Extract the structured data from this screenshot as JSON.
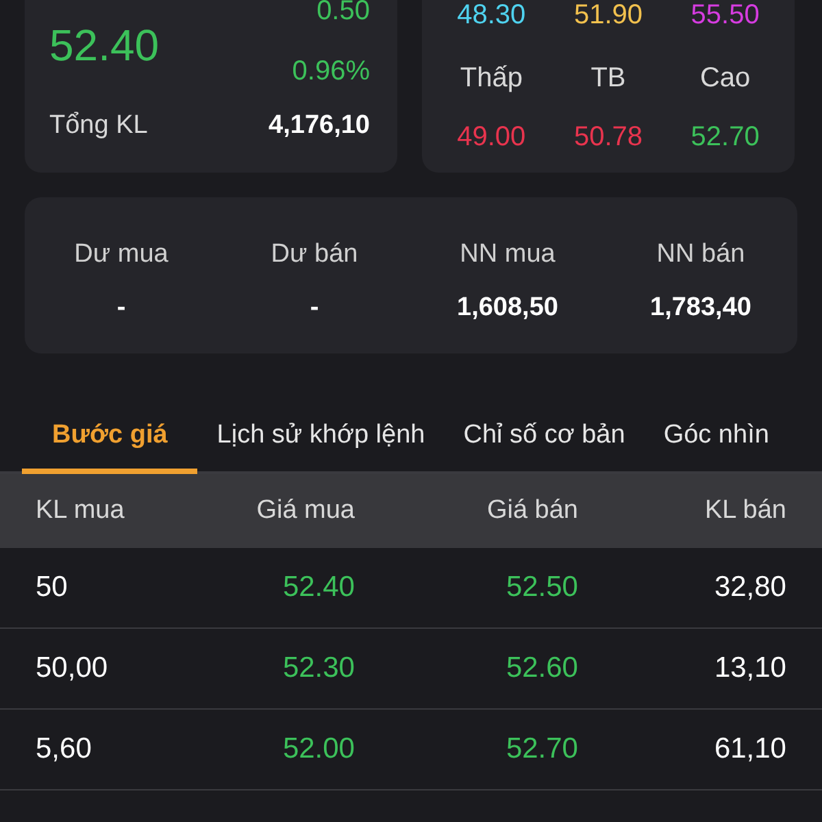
{
  "summary": {
    "price": "52.40",
    "change": "0.50",
    "change_percent": "0.96%",
    "volume_label": "Tổng KL",
    "volume": "4,176,10"
  },
  "price_range": {
    "top_values": [
      {
        "value": "48.30",
        "color": "#4fd3f0"
      },
      {
        "value": "51.90",
        "color": "#f2c14e"
      },
      {
        "value": "55.50",
        "color": "#d63ce0"
      }
    ],
    "labels": [
      "Thấp",
      "TB",
      "Cao"
    ],
    "bottom_values": [
      {
        "value": "49.00",
        "color": "#e8344e"
      },
      {
        "value": "50.78",
        "color": "#e8344e"
      },
      {
        "value": "52.70",
        "color": "#3cc15a"
      }
    ]
  },
  "stats": [
    {
      "label": "Dư mua",
      "value": "-"
    },
    {
      "label": "Dư bán",
      "value": "-"
    },
    {
      "label": "NN mua",
      "value": "1,608,50"
    },
    {
      "label": "NN bán",
      "value": "1,783,40"
    }
  ],
  "tabs": [
    {
      "label": "Bước giá",
      "selected": true
    },
    {
      "label": "Lịch sử khớp lệnh",
      "selected": false
    },
    {
      "label": "Chỉ số cơ bản",
      "selected": false
    },
    {
      "label": "Góc nhìn",
      "selected": false
    }
  ],
  "table": {
    "columns": [
      "KL mua",
      "Giá mua",
      "Giá bán",
      "KL bán"
    ],
    "rows": [
      [
        "50",
        "52.40",
        "52.50",
        "32,80"
      ],
      [
        "50,00",
        "52.30",
        "52.60",
        "13,10"
      ],
      [
        "5,60",
        "52.00",
        "52.70",
        "61,10"
      ]
    ]
  }
}
